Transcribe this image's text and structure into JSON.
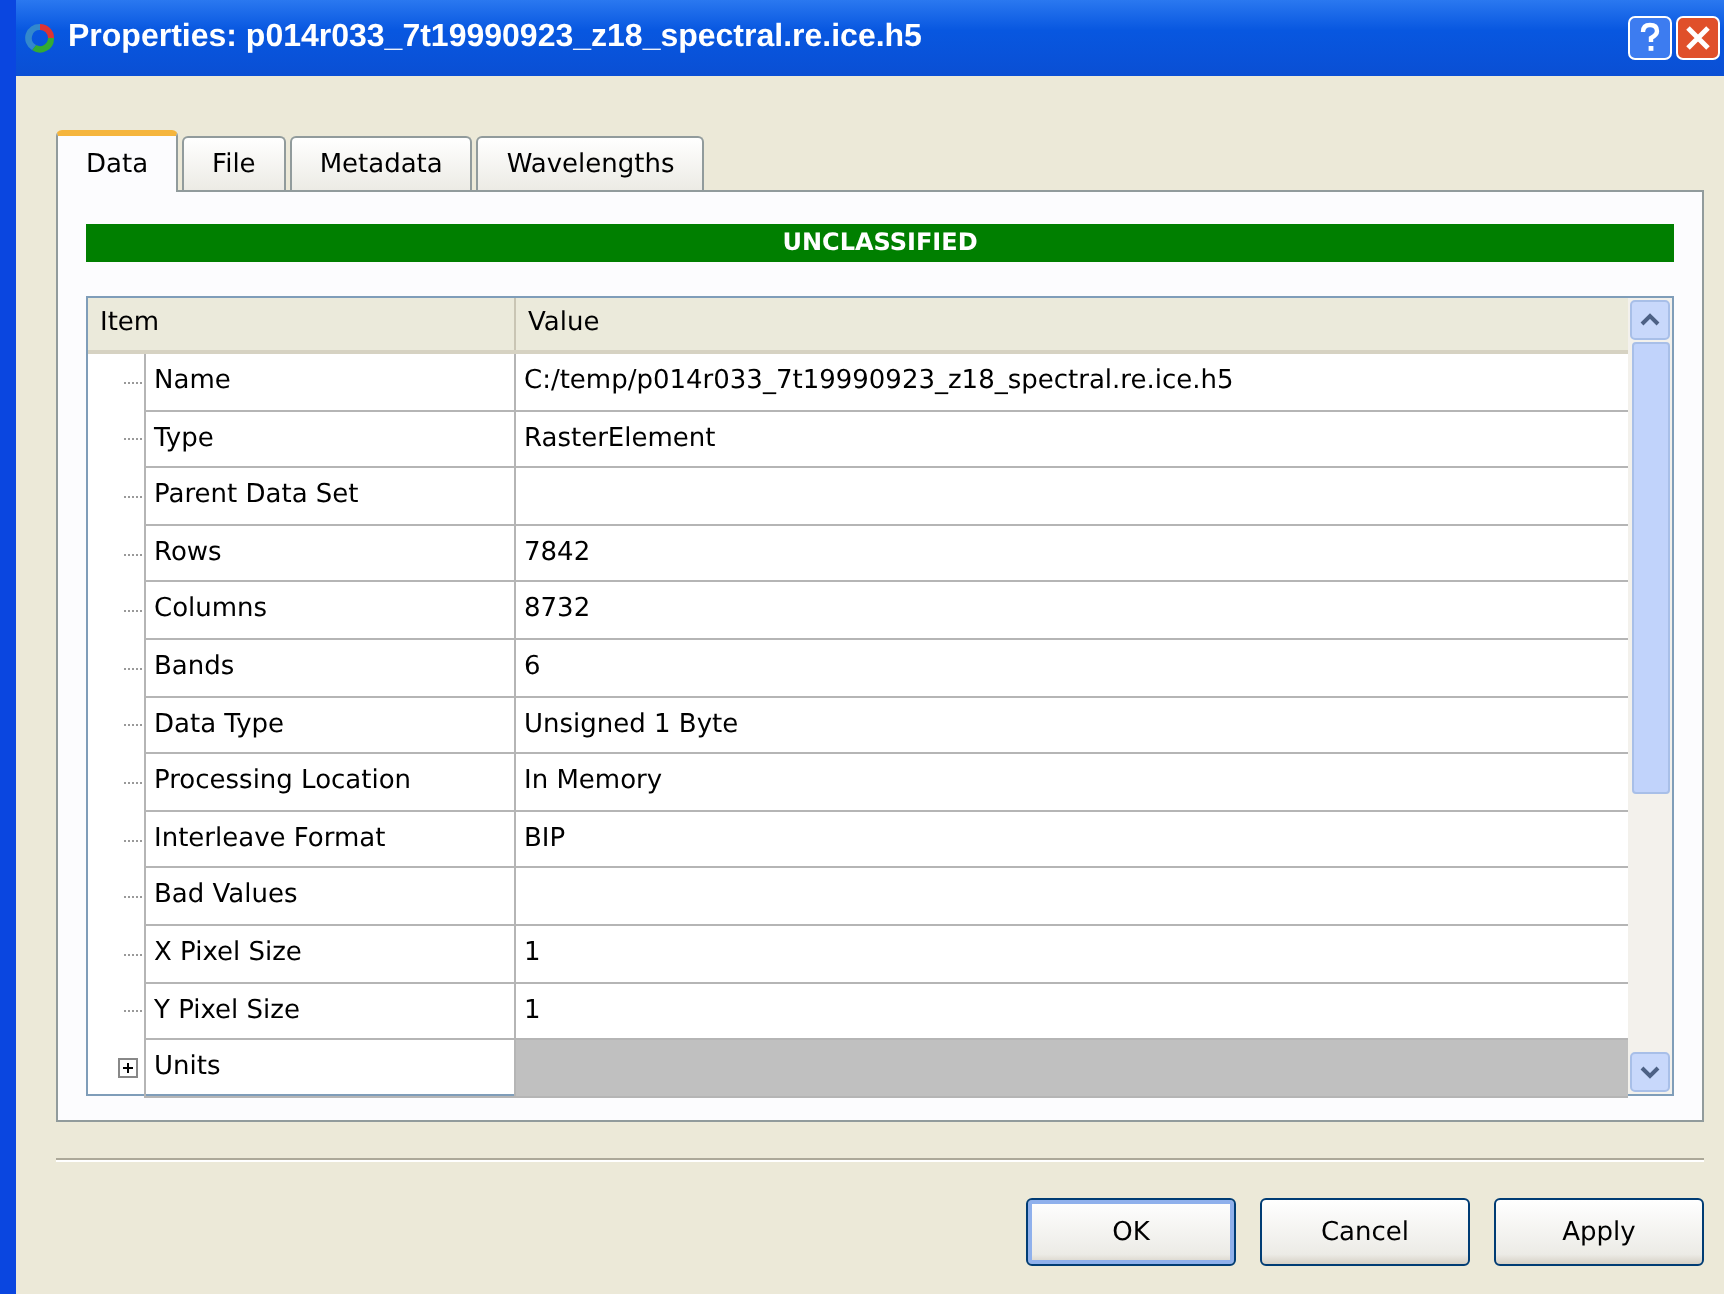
{
  "window": {
    "title": "Properties: p014r033_7t19990923_z18_spectral.re.ice.h5"
  },
  "tabs": [
    {
      "label": "Data",
      "selected": true
    },
    {
      "label": "File",
      "selected": false
    },
    {
      "label": "Metadata",
      "selected": false
    },
    {
      "label": "Wavelengths",
      "selected": false
    }
  ],
  "banner": "UNCLASSIFIED",
  "table": {
    "columns": [
      "Item",
      "Value"
    ],
    "rows": [
      {
        "kind": "leaf",
        "item": "Name",
        "value": "C:/temp/p014r033_7t19990923_z18_spectral.re.ice.h5"
      },
      {
        "kind": "leaf",
        "item": "Type",
        "value": "RasterElement"
      },
      {
        "kind": "leaf",
        "item": "Parent Data Set"
      },
      {
        "kind": "leaf",
        "item": "Rows",
        "value": "7842"
      },
      {
        "kind": "leaf",
        "item": "Columns",
        "value": "8732"
      },
      {
        "kind": "leaf",
        "item": "Bands",
        "value": "6"
      },
      {
        "kind": "leaf",
        "item": "Data Type",
        "value": "Unsigned 1 Byte"
      },
      {
        "kind": "leaf",
        "item": "Processing Location",
        "value": "In Memory"
      },
      {
        "kind": "leaf",
        "item": "Interleave Format",
        "value": "BIP"
      },
      {
        "kind": "leaf",
        "item": "Bad Values"
      },
      {
        "kind": "leaf",
        "item": "X Pixel Size",
        "value": "1"
      },
      {
        "kind": "leaf",
        "item": "Y Pixel Size",
        "value": "1"
      },
      {
        "kind": "group",
        "item": "Units",
        "expanded": false
      }
    ]
  },
  "buttons": [
    {
      "label": "OK",
      "default": true
    },
    {
      "label": "Cancel",
      "default": false
    },
    {
      "label": "Apply",
      "default": false
    }
  ]
}
